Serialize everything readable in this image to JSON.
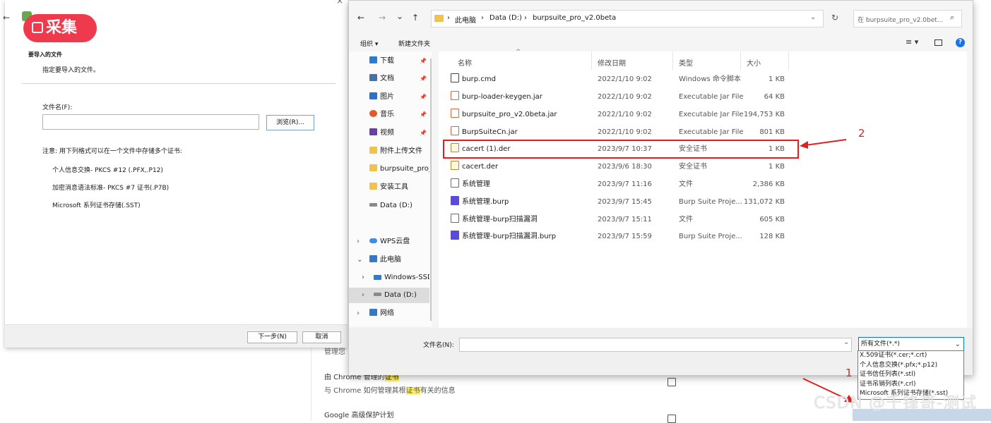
{
  "background_page": {
    "partial_label": "管理您",
    "item1_title_pre": "由 Chrome 管理的",
    "item1_title_hl": "证书",
    "item1_desc_pre": "与 Chrome 如何管理其根",
    "item1_desc_hl": "证书",
    "item1_desc_post": "有关的信息",
    "item2_title": "Google 高级保护计划"
  },
  "badge": {
    "label": "采集"
  },
  "wizard": {
    "heading": "要导入的文件",
    "subheading": "指定要导入的文件。",
    "filename_label": "文件名(F):",
    "filename_value": "",
    "browse_button": "浏览(R)...",
    "note": "注意: 用下列格式可以在一个文件中存储多个证书:",
    "formats": [
      "个人信息交换- PKCS #12 (.PFX,.P12)",
      "加密消息语法标准- PKCS #7 证书(.P7B)",
      "Microsoft 系列证书存储(.SST)"
    ],
    "next_button": "下一步(N)",
    "cancel_button": "取消"
  },
  "dialog": {
    "nav": {
      "back": "←",
      "forward": "→",
      "recent": "⌄",
      "up": "↑"
    },
    "breadcrumb": [
      "此电脑",
      "Data (D:)",
      "burpsuite_pro_v2.0beta"
    ],
    "search_placeholder": "在 burpsuite_pro_v2.0bet...",
    "toolbar": {
      "organize": "组织 ▾",
      "new_folder": "新建文件夹"
    },
    "columns": {
      "name": "名称",
      "modified": "修改日期",
      "type": "类型",
      "size": "大小"
    },
    "sidebar": [
      {
        "label": "下载",
        "icon": "download-icon",
        "color": "#2a7bd4",
        "pinned": true
      },
      {
        "label": "文档",
        "icon": "document-icon",
        "color": "#4a6fa5",
        "pinned": true
      },
      {
        "label": "图片",
        "icon": "picture-icon",
        "color": "#2b70c9",
        "pinned": true
      },
      {
        "label": "音乐",
        "icon": "music-icon",
        "color": "#e05a2a",
        "pinned": true
      },
      {
        "label": "视频",
        "icon": "video-icon",
        "color": "#6b3fa0",
        "pinned": true
      },
      {
        "label": "附件上传文件",
        "icon": "folder-icon",
        "color": "#f2c14e",
        "pinned": false
      },
      {
        "label": "burpsuite_pro_",
        "icon": "folder-icon",
        "color": "#f2c14e",
        "pinned": false
      },
      {
        "label": "安装工具",
        "icon": "folder-icon",
        "color": "#f2c14e",
        "pinned": false
      },
      {
        "label": "Data (D:)",
        "icon": "drive-icon",
        "color": "#8a8a8a",
        "pinned": false
      },
      {
        "label": "WPS云盘",
        "icon": "cloud-icon",
        "color": "#3a8ee6",
        "pinned": false,
        "expand": "›"
      },
      {
        "label": "此电脑",
        "icon": "computer-icon",
        "color": "#3478c6",
        "pinned": false,
        "expand": "⌄"
      },
      {
        "label": "Windows-SSD",
        "icon": "windows-drive-icon",
        "color": "#3478c6",
        "pinned": false,
        "expand": "›"
      },
      {
        "label": "Data (D:)",
        "icon": "drive-icon",
        "color": "#8a8a8a",
        "pinned": false,
        "expand": "›"
      },
      {
        "label": "网络",
        "icon": "network-icon",
        "color": "#3478c6",
        "pinned": false,
        "expand": "›"
      }
    ],
    "files": [
      {
        "name": "burp.cmd",
        "date": "2022/1/10 9:02",
        "type": "Windows 命令脚本",
        "size": "1 KB",
        "icon": "cmd-icon"
      },
      {
        "name": "burp-loader-keygen.jar",
        "date": "2022/1/10 9:02",
        "type": "Executable Jar File",
        "size": "64 KB",
        "icon": "jar-icon"
      },
      {
        "name": "burpsuite_pro_v2.0beta.jar",
        "date": "2022/1/10 9:02",
        "type": "Executable Jar File",
        "size": "194,753 KB",
        "icon": "jar-icon"
      },
      {
        "name": "BurpSuiteCn.jar",
        "date": "2022/1/10 9:02",
        "type": "Executable Jar File",
        "size": "801 KB",
        "icon": "jar-icon"
      },
      {
        "name": "cacert (1).der",
        "date": "2023/9/7 10:37",
        "type": "安全证书",
        "size": "1 KB",
        "icon": "certificate-icon"
      },
      {
        "name": "cacert.der",
        "date": "2023/9/6 18:30",
        "type": "安全证书",
        "size": "1 KB",
        "icon": "certificate-icon"
      },
      {
        "name": "系统管理",
        "date": "2023/9/7 11:16",
        "type": "文件",
        "size": "2,386 KB",
        "icon": "file-icon"
      },
      {
        "name": "系统管理.burp",
        "date": "2023/9/7 15:45",
        "type": "Burp Suite Proje...",
        "size": "131,072 KB",
        "icon": "burp-icon"
      },
      {
        "name": "系统管理-burp扫描漏洞",
        "date": "2023/9/7 15:11",
        "type": "文件",
        "size": "605 KB",
        "icon": "file-icon"
      },
      {
        "name": "系统管理-burp扫描漏洞.burp",
        "date": "2023/9/7 15:59",
        "type": "Burp Suite Proje...",
        "size": "128 KB",
        "icon": "burp-icon"
      }
    ],
    "filename_label": "文件名(N):",
    "filename_value": "",
    "filetype_selected": "所有文件(*.*)",
    "filetype_options": [
      "X.509证书(*.cer;*.crt)",
      "个人信息交换(*.pfx;*.p12)",
      "证书信任列表(*.stl)",
      "证书吊销列表(*.crl)",
      "Microsoft 系列证书存储(*.sst)"
    ]
  },
  "annotations": {
    "marker_1": "1",
    "marker_2": "2"
  },
  "watermark": "CSDN @千锋哥-测试",
  "colors": {
    "annotation_red": "#e02020",
    "badge_red": "#ef3a4e",
    "accent_blue": "#0078d4"
  }
}
